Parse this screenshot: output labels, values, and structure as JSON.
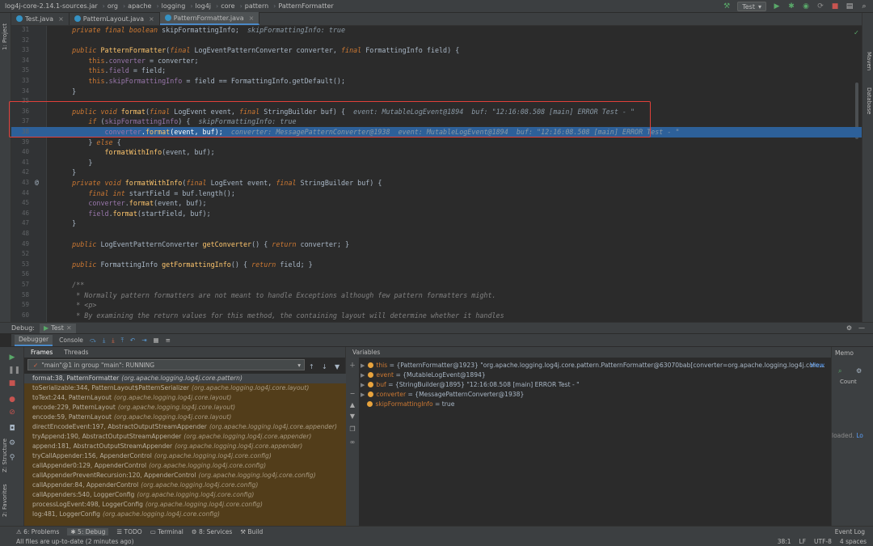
{
  "breadcrumbs": [
    "log4j-core-2.14.1-sources.jar",
    "org",
    "apache",
    "logging",
    "log4j",
    "core",
    "pattern",
    "PatternFormatter"
  ],
  "run_config": "Test",
  "tabs": [
    {
      "label": "Test.java"
    },
    {
      "label": "PatternLayout.java"
    },
    {
      "label": "PatternFormatter.java"
    }
  ],
  "side_tabs": {
    "project": "1: Project",
    "maven": "Maven",
    "database": "Database",
    "structure": "Z: Structure",
    "favorites": "2: Favorites"
  },
  "code_lines": [
    {
      "n": "31",
      "t": "    private final boolean skipFormattingInfo;  skipFormattingInfo: true"
    },
    {
      "n": "32",
      "t": ""
    },
    {
      "n": "33",
      "t": "    public PatternFormatter(final LogEventPatternConverter converter, final FormattingInfo field) {"
    },
    {
      "n": "34",
      "t": "        this.converter = converter;"
    },
    {
      "n": "35",
      "t": "        this.field = field;"
    },
    {
      "n": "33",
      "t": "        this.skipFormattingInfo = field == FormattingInfo.getDefault();"
    },
    {
      "n": "34",
      "t": "    }"
    },
    {
      "n": "35",
      "t": ""
    },
    {
      "n": "36",
      "t": "    public void format(final LogEvent event, final StringBuilder buf) {  event: MutableLogEvent@1894  buf: \"12:16:08.508 [main] ERROR Test - \""
    },
    {
      "n": "37",
      "t": "        if (skipFormattingInfo) {  skipFormattingInfo: true"
    },
    {
      "n": "38",
      "t": "            converter.format(event, buf);  converter: MessagePatternConverter@1938  event: MutableLogEvent@1894  buf: \"12:16:08.508 [main] ERROR Test - \""
    },
    {
      "n": "39",
      "t": "        } else {"
    },
    {
      "n": "40",
      "t": "            formatWithInfo(event, buf);"
    },
    {
      "n": "41",
      "t": "        }"
    },
    {
      "n": "42",
      "t": "    }"
    },
    {
      "n": "43",
      "t": "    private void formatWithInfo(final LogEvent event, final StringBuilder buf) {"
    },
    {
      "n": "44",
      "t": "        final int startField = buf.length();"
    },
    {
      "n": "45",
      "t": "        converter.format(event, buf);"
    },
    {
      "n": "46",
      "t": "        field.format(startField, buf);"
    },
    {
      "n": "47",
      "t": "    }"
    },
    {
      "n": "48",
      "t": ""
    },
    {
      "n": "49",
      "t": "    public LogEventPatternConverter getConverter() { return converter; }"
    },
    {
      "n": "52",
      "t": ""
    },
    {
      "n": "53",
      "t": "    public FormattingInfo getFormattingInfo() { return field; }"
    },
    {
      "n": "56",
      "t": ""
    },
    {
      "n": "57",
      "t": "    /**"
    },
    {
      "n": "58",
      "t": "     * Normally pattern formatters are not meant to handle Exceptions although few pattern formatters might."
    },
    {
      "n": "59",
      "t": "     * <p>"
    },
    {
      "n": "60",
      "t": "     * By examining the return values for this method, the containing layout will determine whether it handles"
    }
  ],
  "debug": {
    "label": "Debug:",
    "session": "Test",
    "tab_debugger": "Debugger",
    "tab_console": "Console",
    "frames_tab": "Frames",
    "threads_tab": "Threads",
    "thread": "\"main\"@1 in group \"main\": RUNNING",
    "variables_label": "Variables",
    "frames": [
      {
        "m": "format:38, PatternFormatter",
        "p": "(org.apache.logging.log4j.core.pattern)"
      },
      {
        "m": "toSerializable:344, PatternLayout$PatternSerializer",
        "p": "(org.apache.logging.log4j.core.layout)"
      },
      {
        "m": "toText:244, PatternLayout",
        "p": "(org.apache.logging.log4j.core.layout)"
      },
      {
        "m": "encode:229, PatternLayout",
        "p": "(org.apache.logging.log4j.core.layout)"
      },
      {
        "m": "encode:59, PatternLayout",
        "p": "(org.apache.logging.log4j.core.layout)"
      },
      {
        "m": "directEncodeEvent:197, AbstractOutputStreamAppender",
        "p": "(org.apache.logging.log4j.core.appender)"
      },
      {
        "m": "tryAppend:190, AbstractOutputStreamAppender",
        "p": "(org.apache.logging.log4j.core.appender)"
      },
      {
        "m": "append:181, AbstractOutputStreamAppender",
        "p": "(org.apache.logging.log4j.core.appender)"
      },
      {
        "m": "tryCallAppender:156, AppenderControl",
        "p": "(org.apache.logging.log4j.core.config)"
      },
      {
        "m": "callAppender0:129, AppenderControl",
        "p": "(org.apache.logging.log4j.core.config)"
      },
      {
        "m": "callAppenderPreventRecursion:120, AppenderControl",
        "p": "(org.apache.logging.log4j.core.config)"
      },
      {
        "m": "callAppender:84, AppenderControl",
        "p": "(org.apache.logging.log4j.core.config)"
      },
      {
        "m": "callAppenders:540, LoggerConfig",
        "p": "(org.apache.logging.log4j.core.config)"
      },
      {
        "m": "processLogEvent:498, LoggerConfig",
        "p": "(org.apache.logging.log4j.core.config)"
      },
      {
        "m": "log:481, LoggerConfig",
        "p": "(org.apache.logging.log4j.core.config)"
      }
    ],
    "variables": [
      {
        "name": "this",
        "val": " = {PatternFormatter@1923} \"org.apache.logging.log4j.core.pattern.PatternFormatter@63070bab[converter=org.apache.logging.log4j.core...",
        "link": "View",
        "color": "#e8a33d",
        "expand": true
      },
      {
        "name": "event",
        "val": " = {MutableLogEvent@1894}",
        "color": "#e8a33d",
        "expand": true
      },
      {
        "name": "buf",
        "val": " = {StringBuilder@1895} \"12:16:08.508 [main] ERROR Test - \"",
        "color": "#e8a33d",
        "expand": true
      },
      {
        "name": "converter",
        "val": " = {MessagePatternConverter@1938}",
        "color": "#e8a33d",
        "expand": true
      },
      {
        "name": "skipFormattingInfo",
        "val": " = true",
        "color": "#e8a33d",
        "expand": false
      }
    ],
    "memory": "Memo",
    "count": "Count",
    "loaded": "loaded.",
    "loaded_link": "Lo"
  },
  "bottom_tabs": [
    "6: Problems",
    "5: Debug",
    "TODO",
    "Terminal",
    "8: Services",
    "Build"
  ],
  "event_log": "Event Log",
  "status": {
    "message": "All files are up-to-date (2 minutes ago)",
    "pos": "38:1",
    "lf": "LF",
    "enc": "UTF-8",
    "indent": "4 spaces"
  }
}
